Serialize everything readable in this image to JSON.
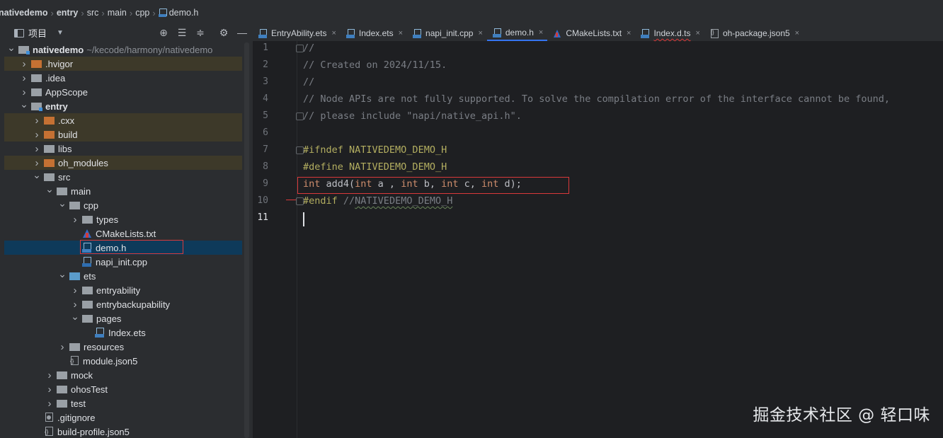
{
  "breadcrumb": [
    "nativedemo",
    "entry",
    "src",
    "main",
    "cpp",
    "demo.h"
  ],
  "panel": {
    "title": "项目"
  },
  "tree": [
    {
      "label": "nativedemo",
      "path": "~/kecode/harmony/nativedemo",
      "depth": 0,
      "arrow": "down",
      "icon": "module",
      "bold": true,
      "hl": false
    },
    {
      "label": ".hvigor",
      "depth": 1,
      "arrow": "right",
      "icon": "orange",
      "hl": true
    },
    {
      "label": ".idea",
      "depth": 1,
      "arrow": "right",
      "icon": "gray",
      "hl": false
    },
    {
      "label": "AppScope",
      "depth": 1,
      "arrow": "right",
      "icon": "gray",
      "hl": false
    },
    {
      "label": "entry",
      "depth": 1,
      "arrow": "down",
      "icon": "module",
      "bold": true,
      "hl": false
    },
    {
      "label": ".cxx",
      "depth": 2,
      "arrow": "right",
      "icon": "orange",
      "hl": true
    },
    {
      "label": "build",
      "depth": 2,
      "arrow": "right",
      "icon": "orange",
      "hl": true
    },
    {
      "label": "libs",
      "depth": 2,
      "arrow": "right",
      "icon": "gray",
      "hl": false
    },
    {
      "label": "oh_modules",
      "depth": 2,
      "arrow": "right",
      "icon": "orange",
      "hl": true
    },
    {
      "label": "src",
      "depth": 2,
      "arrow": "down",
      "icon": "gray",
      "hl": false
    },
    {
      "label": "main",
      "depth": 3,
      "arrow": "down",
      "icon": "gray",
      "hl": false
    },
    {
      "label": "cpp",
      "depth": 4,
      "arrow": "down",
      "icon": "gray",
      "hl": false
    },
    {
      "label": "types",
      "depth": 5,
      "arrow": "right",
      "icon": "gray",
      "hl": false
    },
    {
      "label": "CMakeLists.txt",
      "depth": 5,
      "arrow": "none",
      "icon": "cmake",
      "hl": false
    },
    {
      "label": "demo.h",
      "depth": 5,
      "arrow": "none",
      "icon": "h",
      "hl": false,
      "sel": true
    },
    {
      "label": "napi_init.cpp",
      "depth": 5,
      "arrow": "none",
      "icon": "cpp",
      "hl": false
    },
    {
      "label": "ets",
      "depth": 4,
      "arrow": "down",
      "icon": "blue",
      "hl": false
    },
    {
      "label": "entryability",
      "depth": 5,
      "arrow": "right",
      "icon": "gray",
      "hl": false
    },
    {
      "label": "entrybackupability",
      "depth": 5,
      "arrow": "right",
      "icon": "gray",
      "hl": false
    },
    {
      "label": "pages",
      "depth": 5,
      "arrow": "down",
      "icon": "gray",
      "hl": false
    },
    {
      "label": "Index.ets",
      "depth": 6,
      "arrow": "none",
      "icon": "ets",
      "hl": false
    },
    {
      "label": "resources",
      "depth": 4,
      "arrow": "right",
      "icon": "gray",
      "hl": false
    },
    {
      "label": "module.json5",
      "depth": 4,
      "arrow": "none",
      "icon": "json",
      "hl": false
    },
    {
      "label": "mock",
      "depth": 3,
      "arrow": "right",
      "icon": "gray",
      "hl": false
    },
    {
      "label": "ohosTest",
      "depth": 3,
      "arrow": "right",
      "icon": "gray",
      "hl": false
    },
    {
      "label": "test",
      "depth": 3,
      "arrow": "right",
      "icon": "gray",
      "hl": false
    },
    {
      "label": ".gitignore",
      "depth": 2,
      "arrow": "none",
      "icon": "git",
      "hl": false
    },
    {
      "label": "build-profile.json5",
      "depth": 2,
      "arrow": "none",
      "icon": "json",
      "hl": false
    }
  ],
  "tabs": [
    {
      "label": "EntryAbility.ets",
      "icon": "ets",
      "active": false,
      "wavy": false
    },
    {
      "label": "Index.ets",
      "icon": "ets",
      "active": false,
      "wavy": false
    },
    {
      "label": "napi_init.cpp",
      "icon": "cpp",
      "active": false,
      "wavy": false
    },
    {
      "label": "demo.h",
      "icon": "h",
      "active": true,
      "wavy": false
    },
    {
      "label": "CMakeLists.txt",
      "icon": "cmake",
      "active": false,
      "wavy": false
    },
    {
      "label": "Index.d.ts",
      "icon": "ets",
      "active": false,
      "wavy": true
    },
    {
      "label": "oh-package.json5",
      "icon": "json",
      "active": false,
      "wavy": false
    }
  ],
  "code": [
    {
      "n": "1",
      "parts": [
        {
          "t": "//",
          "c": "cm"
        }
      ],
      "fold": true
    },
    {
      "n": "2",
      "parts": [
        {
          "t": "// Created on 2024/11/15.",
          "c": "cm"
        }
      ]
    },
    {
      "n": "3",
      "parts": [
        {
          "t": "//",
          "c": "cm"
        }
      ]
    },
    {
      "n": "4",
      "parts": [
        {
          "t": "// Node APIs are not fully supported. To solve the compilation error of the interface cannot be found,",
          "c": "cm"
        }
      ]
    },
    {
      "n": "5",
      "parts": [
        {
          "t": "// please include \"napi/native_api.h\".",
          "c": "cm"
        }
      ],
      "fold": true
    },
    {
      "n": "6",
      "parts": []
    },
    {
      "n": "7",
      "parts": [
        {
          "t": "#ifndef ",
          "c": "pp"
        },
        {
          "t": "NATIVEDEMO_DEMO_H",
          "c": "mac"
        }
      ],
      "fold": true
    },
    {
      "n": "8",
      "parts": [
        {
          "t": "#define ",
          "c": "pp"
        },
        {
          "t": "NATIVEDEMO_DEMO_H",
          "c": "mac"
        }
      ]
    },
    {
      "n": "9",
      "parts": [
        {
          "t": "int ",
          "c": "kw"
        },
        {
          "t": "add4(",
          "c": "fn"
        },
        {
          "t": "int ",
          "c": "kw"
        },
        {
          "t": "a , ",
          "c": "def"
        },
        {
          "t": "int ",
          "c": "kw"
        },
        {
          "t": "b, ",
          "c": "def"
        },
        {
          "t": "int ",
          "c": "kw"
        },
        {
          "t": "c, ",
          "c": "def"
        },
        {
          "t": "int ",
          "c": "kw"
        },
        {
          "t": "d);",
          "c": "def"
        }
      ]
    },
    {
      "n": "10",
      "parts": [
        {
          "t": "#endif ",
          "c": "pp"
        },
        {
          "t": "//",
          "c": "cm"
        },
        {
          "t": "NATIVEDEMO_DEMO_H",
          "c": "cm wav"
        }
      ],
      "fold": true
    },
    {
      "n": "11",
      "parts": [],
      "current": true
    }
  ],
  "watermark": "掘金技术社区 @ 轻口味"
}
